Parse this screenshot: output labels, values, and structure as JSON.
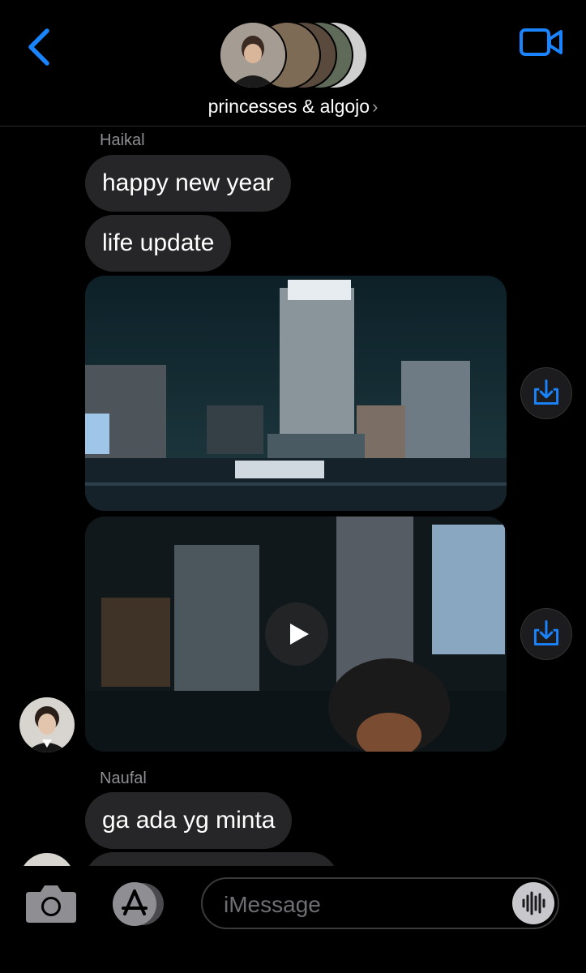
{
  "header": {
    "title": "princesses & algojo",
    "chevron": "›",
    "back_icon": "chevron-left-icon",
    "video_icon": "video-camera-icon",
    "accent_color": "#1a84ff"
  },
  "messages": {
    "group1_sender": "Haikal",
    "m1": "happy new year",
    "m2": "life update",
    "group2_sender": "Naufal",
    "m3": "ga ada yg minta"
  },
  "compose": {
    "placeholder": "iMessage",
    "camera_icon": "camera-icon",
    "appstore_icon": "app-store-icon",
    "audio_icon": "waveform-icon"
  },
  "colors": {
    "background": "#000000",
    "bubble": "#262628",
    "sender": "#8e8e93"
  }
}
